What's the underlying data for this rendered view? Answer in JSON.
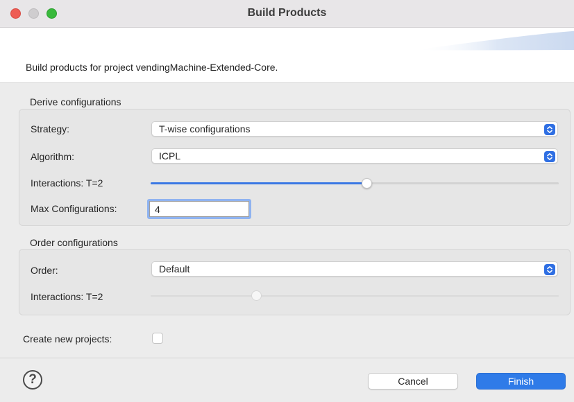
{
  "window": {
    "title": "Build Products"
  },
  "header": {
    "description": "Build products for project vendingMachine-Extended-Core."
  },
  "derive": {
    "group_title": "Derive configurations",
    "strategy_label": "Strategy:",
    "strategy_value": "T-wise configurations",
    "algorithm_label": "Algorithm:",
    "algorithm_value": "ICPL",
    "interactions_label": "Interactions: T=2",
    "interactions_slider_fraction": 0.53,
    "max_configs_label": "Max Configurations:",
    "max_configs_value": "4"
  },
  "order": {
    "group_title": "Order configurations",
    "order_label": "Order:",
    "order_value": "Default",
    "interactions_label": "Interactions: T=2",
    "interactions_slider_fraction": 0.26,
    "interactions_enabled": false
  },
  "create_projects": {
    "label": "Create new projects:",
    "checked": false
  },
  "footer": {
    "help_glyph": "?",
    "cancel_label": "Cancel",
    "finish_label": "Finish"
  },
  "icons": {
    "close": "close-icon",
    "minimize": "minimize-icon",
    "maximize": "maximize-icon",
    "select_arrows": "chevron-updown-icon",
    "help": "help-icon"
  },
  "colors": {
    "accent": "#2f7be8",
    "close": "#ee5d55",
    "maximize": "#39b93c",
    "slider_fill": "#3a78e4",
    "focus_ring": "#8fb3f0"
  }
}
